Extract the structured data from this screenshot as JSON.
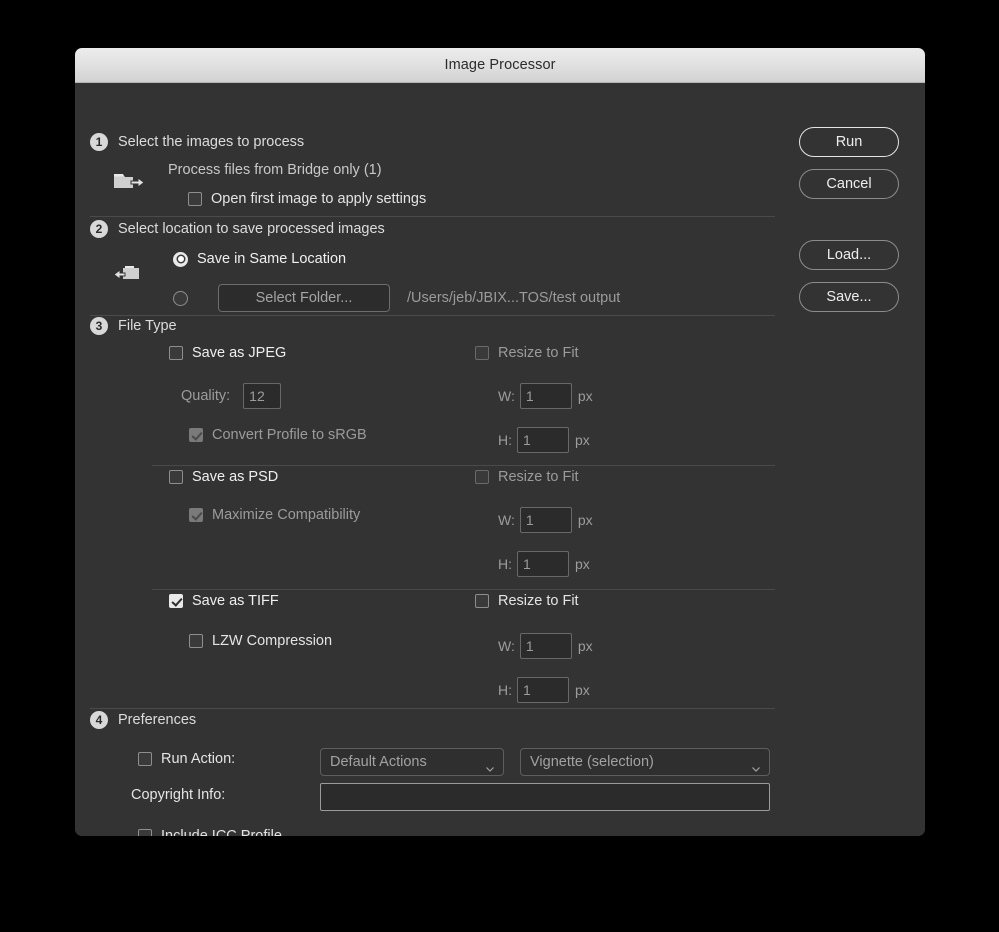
{
  "window": {
    "title": "Image Processor"
  },
  "buttons": {
    "run": "Run",
    "cancel": "Cancel",
    "load": "Load...",
    "save": "Save..."
  },
  "step1": {
    "number": "1",
    "title": "Select the images to process",
    "source_label": "Process files from Bridge only (1)",
    "open_first": {
      "label": "Open first image to apply settings",
      "checked": false
    },
    "icon": "folder-export-icon"
  },
  "step2": {
    "number": "2",
    "title": "Select location to save processed images",
    "same_location": {
      "label": "Save in Same Location",
      "selected": true
    },
    "select_folder": {
      "label": "Select Folder...",
      "selected": false
    },
    "path": "/Users/jeb/JBIX...TOS/test output",
    "icon": "folder-import-icon"
  },
  "step3": {
    "number": "3",
    "title": "File Type",
    "jpeg": {
      "label": "Save as JPEG",
      "checked": false,
      "quality_label": "Quality:",
      "quality_value": "12",
      "convert_srgb_label": "Convert Profile to sRGB",
      "convert_srgb_checked": true,
      "resize_label": "Resize to Fit",
      "resize_checked": false,
      "w_label": "W:",
      "w_value": "1",
      "h_label": "H:",
      "h_value": "1",
      "unit": "px"
    },
    "psd": {
      "label": "Save as PSD",
      "checked": false,
      "maximize_label": "Maximize Compatibility",
      "maximize_checked": true,
      "resize_label": "Resize to Fit",
      "resize_checked": false,
      "w_label": "W:",
      "w_value": "1",
      "h_label": "H:",
      "h_value": "1",
      "unit": "px"
    },
    "tiff": {
      "label": "Save as TIFF",
      "checked": true,
      "lzw_label": "LZW Compression",
      "lzw_checked": false,
      "resize_label": "Resize to Fit",
      "resize_checked": false,
      "w_label": "W:",
      "w_value": "1",
      "h_label": "H:",
      "h_value": "1",
      "unit": "px"
    }
  },
  "step4": {
    "number": "4",
    "title": "Preferences",
    "run_action": {
      "label": "Run Action:",
      "checked": false,
      "set_value": "Default Actions",
      "action_value": "Vignette (selection)"
    },
    "copyright": {
      "label": "Copyright Info:",
      "value": ""
    },
    "icc": {
      "label": "Include ICC Profile",
      "checked": false
    }
  },
  "colors": {
    "dialog_bg": "#333333",
    "titlebar_top": "#ececec",
    "titlebar_bottom": "#d2d2d2",
    "field_bg": "#2b2b2b",
    "text": "#e4e4e4",
    "text_muted": "#9b9b9b"
  }
}
